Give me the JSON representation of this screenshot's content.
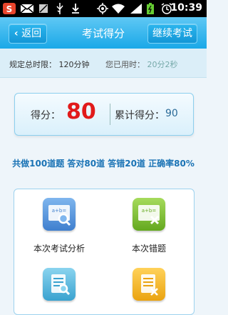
{
  "statusbar": {
    "time": "10:39"
  },
  "header": {
    "back_label": "返回",
    "title": "考试得分",
    "continue_label": "继续考试"
  },
  "timebar": {
    "limit_label": "规定总时限：",
    "limit_value": "120分钟",
    "used_label": "您已用时：",
    "used_value": "20分2秒"
  },
  "score": {
    "label": "得分：",
    "value": "80",
    "total_label": "累计得分：",
    "total_value": "90"
  },
  "summary": "共做100道题 答对80道 答错20道 正确率80%",
  "menu": [
    {
      "label": "本次考试分析",
      "icon": "exam-analysis-icon",
      "color": "#4f8fd8"
    },
    {
      "label": "本次错题",
      "icon": "wrong-questions-icon",
      "color": "#7dbf2f"
    },
    {
      "label": "",
      "icon": "document-search-icon",
      "color": "#4ab0d8"
    },
    {
      "label": "",
      "icon": "document-list-icon",
      "color": "#f2b21c"
    }
  ],
  "colors": {
    "titlebar": "#1aa8e8",
    "score": "#e11a1a",
    "summary": "#1a73b5"
  }
}
